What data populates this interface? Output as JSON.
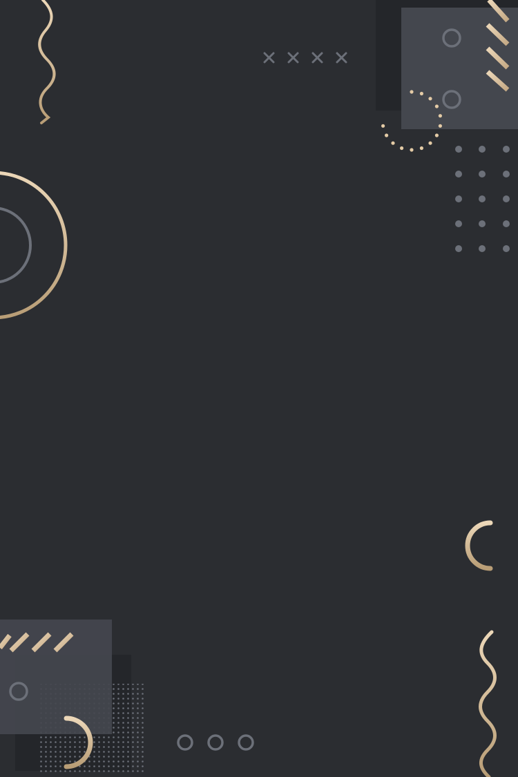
{
  "background": {
    "base_color": "#2b2d31",
    "panel_light": "#44474e",
    "panel_dark": "#24262a",
    "accent_gray": "#6c7079",
    "gold_light": "#e9d3b2",
    "gold_dark": "#b59b74"
  },
  "decorations": [
    "wavy-line",
    "x-mark-row",
    "square-panel",
    "diagonal-stripes",
    "ring",
    "dotted-arc",
    "dot-grid",
    "concentric-circles",
    "half-circle",
    "halftone-dots"
  ]
}
